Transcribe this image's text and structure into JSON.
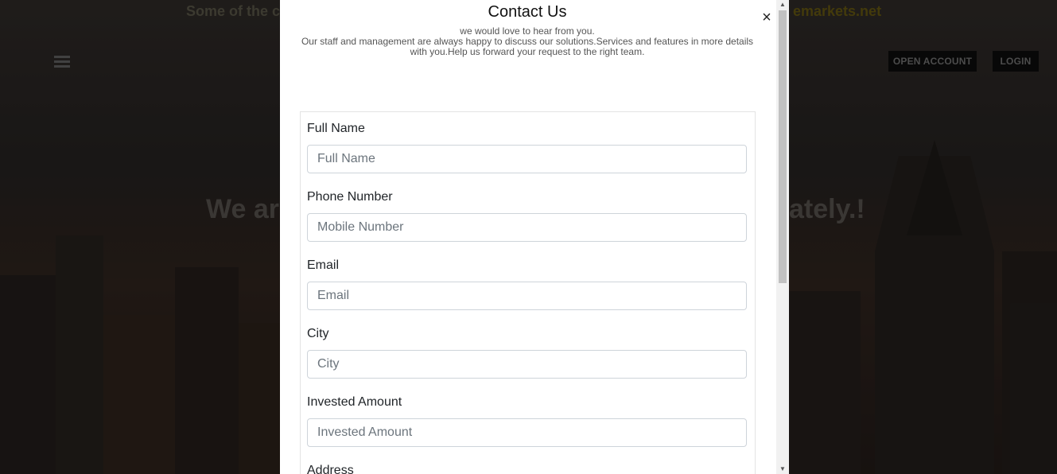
{
  "background": {
    "ticker_text": "Some of the c",
    "ticker_right_text": "emarkets.net",
    "hero_left": "We are",
    "hero_right": "ately.!",
    "nav": {
      "open_account_label": "OPEN ACCOUNT",
      "login_label": "LOGIN"
    }
  },
  "modal": {
    "title": "Contact Us",
    "close_symbol": "×",
    "subtitle_line1": "we would love to hear from you.",
    "subtitle_line2": "Our staff and management are always happy to discuss our solutions.Services and features in more details with you.Help us forward your request to the right team.",
    "fields": [
      {
        "label": "Full Name",
        "placeholder": "Full Name",
        "value": ""
      },
      {
        "label": "Phone Number",
        "placeholder": "Mobile Number",
        "value": ""
      },
      {
        "label": "Email",
        "placeholder": "Email",
        "value": ""
      },
      {
        "label": "City",
        "placeholder": "City",
        "value": ""
      },
      {
        "label": "Invested Amount",
        "placeholder": "Invested Amount",
        "value": ""
      },
      {
        "label": "Address"
      }
    ]
  },
  "icons": {
    "menu": "hamburger-icon",
    "close": "close-icon",
    "scroll_up": "arrow-up-icon",
    "scroll_down": "arrow-down-icon"
  },
  "colors": {
    "modal_bg": "#ffffff",
    "input_border": "#ced4da",
    "label_text": "#212529",
    "nav_button_bg": "#0f0f0f"
  }
}
